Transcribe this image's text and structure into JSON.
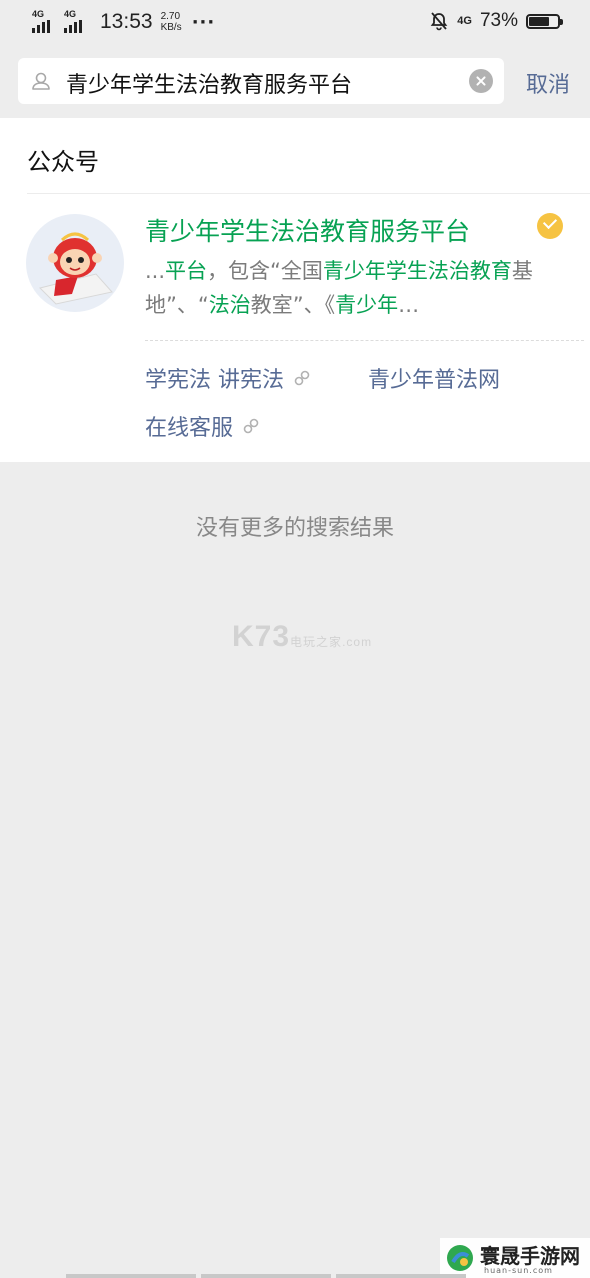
{
  "status_bar": {
    "sim1": "4G",
    "sim2": "4G",
    "time": "13:53",
    "speed_value": "2.70",
    "speed_unit": "KB/s",
    "dots": "···",
    "net_badge": "4G",
    "battery_text": "73%",
    "battery_level": 0.73,
    "icons": [
      "signal-icon",
      "mute-bell-icon",
      "battery-icon"
    ]
  },
  "search": {
    "query": "青少年学生法治教育服务平台",
    "cancel_label": "取消"
  },
  "results": {
    "section_title": "公众号",
    "account": {
      "name": "青少年学生法治教育服务平台",
      "desc_parts": [
        {
          "t": "...",
          "hl": false
        },
        {
          "t": "平台",
          "hl": true
        },
        {
          "t": "，包含“全国",
          "hl": false
        },
        {
          "t": "青少年学生法治教育",
          "hl": true
        },
        {
          "t": "基地”、“",
          "hl": false
        },
        {
          "t": "法治",
          "hl": true
        },
        {
          "t": "教室”、《",
          "hl": false
        },
        {
          "t": "青少年",
          "hl": true
        },
        {
          "t": "…",
          "hl": false
        }
      ],
      "links": [
        {
          "label": "学宪法 讲宪法",
          "mini_program": true
        },
        {
          "label": "青少年普法网",
          "mini_program": false
        },
        {
          "label": "在线客服",
          "mini_program": true
        }
      ]
    }
  },
  "footer": {
    "no_more": "没有更多的搜索结果"
  },
  "watermark": {
    "logo": "K73",
    "sub1": "电玩之家",
    "sub2": ".com"
  },
  "corner_logo": {
    "title": "寰晟手游网",
    "url": "huan-sun.com"
  },
  "colors": {
    "highlight": "#07a253",
    "link": "#576b95",
    "background": "#ededed",
    "verified": "#f6c342"
  }
}
